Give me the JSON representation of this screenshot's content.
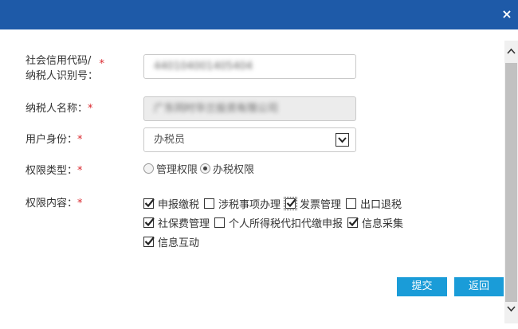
{
  "dialog": {
    "close_glyph": "×"
  },
  "form": {
    "credit_code_label_1": "社会信用代码/",
    "credit_code_label_2": "纳税人识别号：",
    "credit_code_value": "440104001405404",
    "taxpayer_name_label": "纳税人名称：",
    "taxpayer_name_value": "广东同时华兰投资有限公司",
    "identity_label": "用户身份：",
    "identity_value": "办税员",
    "perm_type_label": "权限类型：",
    "perm_type_options": [
      "管理权限",
      "办税权限"
    ],
    "perm_type_selected": "办税权限",
    "perm_content_label": "权限内容：",
    "required_mark": "*",
    "permissions": [
      {
        "label": "申报缴税",
        "checked": true
      },
      {
        "label": "涉税事项办理",
        "checked": false
      },
      {
        "label": "发票管理",
        "checked": true
      },
      {
        "label": "出口退税",
        "checked": false
      },
      {
        "label": "社保费管理",
        "checked": true
      },
      {
        "label": "个人所得税代扣代缴申报",
        "checked": false
      },
      {
        "label": "信息采集",
        "checked": true
      },
      {
        "label": "信息互动",
        "checked": true
      }
    ]
  },
  "buttons": {
    "submit": "提交",
    "back": "返回"
  },
  "colors": {
    "header": "#1e5aa8",
    "button": "#1a9cd8",
    "required": "#d9262c"
  }
}
